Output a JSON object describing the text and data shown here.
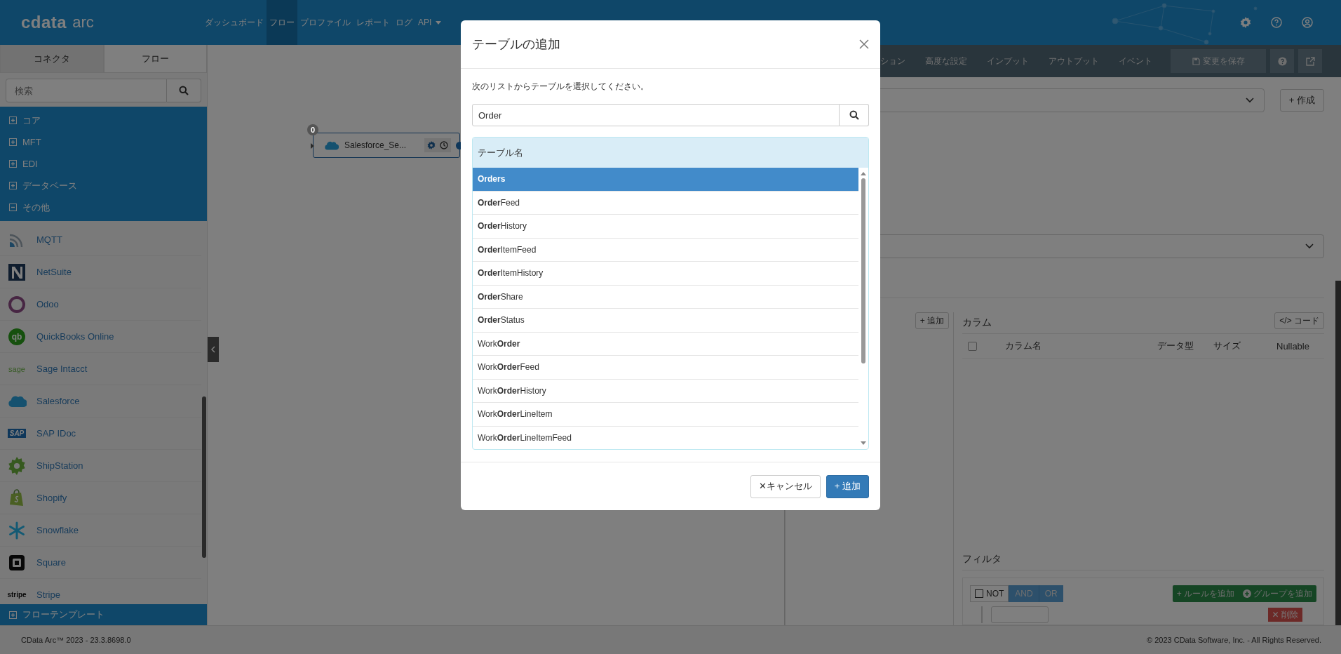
{
  "header": {
    "logo": "cdata",
    "logo_suffix": "arc",
    "nav": [
      {
        "label": "ダッシュボード",
        "selected": false,
        "dropdown": false
      },
      {
        "label": "フロー",
        "selected": true,
        "dropdown": false
      },
      {
        "label": "プロファイル",
        "selected": false,
        "dropdown": false
      },
      {
        "label": "レポート",
        "selected": false,
        "dropdown": false
      },
      {
        "label": "ログ",
        "selected": false,
        "dropdown": false
      },
      {
        "label": "API",
        "selected": false,
        "dropdown": true
      }
    ]
  },
  "sidebar": {
    "tabs": [
      {
        "label": "コネクタ",
        "selected": true
      },
      {
        "label": "フロー",
        "selected": false
      }
    ],
    "search": {
      "placeholder": "検索"
    },
    "categories": [
      {
        "label": "コア",
        "expanded": false
      },
      {
        "label": "MFT",
        "expanded": false
      },
      {
        "label": "EDI",
        "expanded": false
      },
      {
        "label": "データベース",
        "expanded": false
      },
      {
        "label": "その他",
        "expanded": true
      }
    ],
    "connectors": [
      {
        "name": "MQTT"
      },
      {
        "name": "NetSuite"
      },
      {
        "name": "Odoo"
      },
      {
        "name": "QuickBooks Online",
        "logo_text": "qb"
      },
      {
        "name": "Sage Intacct",
        "logo_text": "sage"
      },
      {
        "name": "Salesforce"
      },
      {
        "name": "SAP IDoc",
        "logo_text": "SAP"
      },
      {
        "name": "ShipStation"
      },
      {
        "name": "Shopify"
      },
      {
        "name": "Snowflake"
      },
      {
        "name": "Square"
      },
      {
        "name": "Stripe",
        "logo_text": "stripe"
      }
    ],
    "templates": {
      "label": "フローテンプレート",
      "expanded": false
    }
  },
  "canvas": {
    "node": {
      "label": "Salesforce_Se...",
      "badge": "0"
    }
  },
  "panel": {
    "tabs": [
      {
        "label": "ション",
        "selected": false
      },
      {
        "label": "高度な設定",
        "selected": false
      },
      {
        "label": "インプット",
        "selected": false
      },
      {
        "label": "アウトプット",
        "selected": false
      },
      {
        "label": "イベント",
        "selected": false
      }
    ],
    "save_button": "変更を保存",
    "create_button": "+ 作成",
    "add_button": "+ 追加",
    "columns": {
      "title": "カラム",
      "code_button": "</> コード",
      "select_all": {
        "checked": false
      },
      "headers": [
        "カラム名",
        "データ型",
        "サイズ",
        "Nullable"
      ]
    },
    "filter": {
      "title": "フィルタ",
      "not": {
        "label": "NOT",
        "checked": false
      },
      "operators": [
        "AND",
        "OR"
      ],
      "add_rule": "+ ルールを追加",
      "add_group": "グループを追加",
      "delete": "✕ 削除"
    }
  },
  "modal": {
    "title": "テーブルの追加",
    "instruction": "次のリストからテーブルを選択してください。",
    "search": {
      "value": "Order"
    },
    "table": {
      "column": "テーブル名",
      "rows": [
        {
          "name": "**Order**s",
          "selected": true
        },
        {
          "name": "**Order**Feed",
          "selected": false
        },
        {
          "name": "**Order**History",
          "selected": false
        },
        {
          "name": "**Order**ItemFeed",
          "selected": false
        },
        {
          "name": "**Order**ItemHistory",
          "selected": false
        },
        {
          "name": "**Order**Share",
          "selected": false
        },
        {
          "name": "**Order**Status",
          "selected": false
        },
        {
          "name": "Work**Order**",
          "selected": false
        },
        {
          "name": "Work**Order**Feed",
          "selected": false
        },
        {
          "name": "Work**Order**History",
          "selected": false
        },
        {
          "name": "Work**Order**LineItem",
          "selected": false
        },
        {
          "name": "Work**Order**LineItemFeed",
          "selected": false
        }
      ]
    },
    "buttons": [
      {
        "label": "✕キャンセル",
        "kind": "cancel"
      },
      {
        "label": "+ 追加",
        "kind": "primary"
      }
    ]
  },
  "footer": {
    "version": "CData Arc™ 2023 - 23.3.8698.0",
    "copyright": "© 2023 CData Software, Inc. - All Rights Reserved."
  }
}
